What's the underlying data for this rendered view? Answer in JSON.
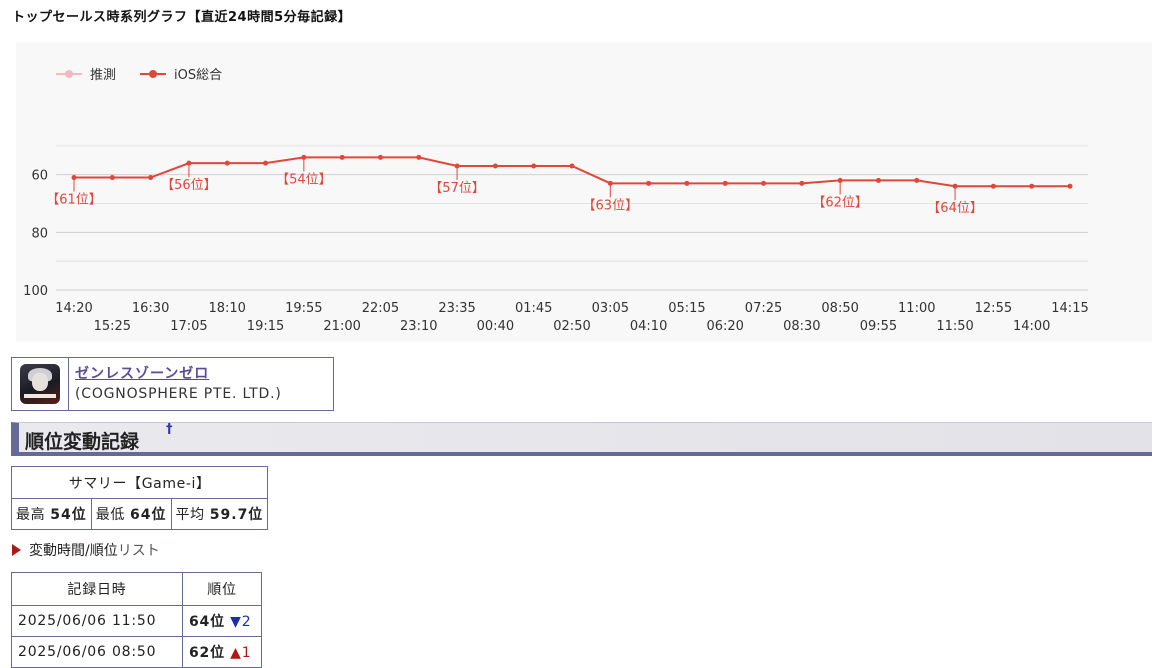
{
  "page_title": "トップセールス時系列グラフ【直近24時間5分毎記録】",
  "legend": [
    {
      "label": "推測",
      "color": "#f7b7c4"
    },
    {
      "label": "iOS総合",
      "color": "#e0473a"
    }
  ],
  "chart_data": {
    "type": "line",
    "x": [
      "14:20",
      "15:25",
      "16:30",
      "17:05",
      "18:10",
      "19:15",
      "19:55",
      "21:00",
      "22:05",
      "23:10",
      "23:35",
      "00:40",
      "01:45",
      "02:50",
      "03:05",
      "04:10",
      "05:15",
      "06:20",
      "07:25",
      "08:30",
      "08:50",
      "09:55",
      "11:00",
      "11:50",
      "12:55",
      "14:00",
      "14:15"
    ],
    "series": [
      {
        "name": "iOS総合",
        "color": "#e0473a",
        "values": [
          61,
          61,
          61,
          56,
          56,
          56,
          54,
          54,
          54,
          54,
          57,
          57,
          57,
          57,
          63,
          63,
          63,
          63,
          63,
          63,
          62,
          62,
          62,
          64,
          64,
          64,
          64
        ]
      }
    ],
    "annotations": [
      {
        "index": 0,
        "label": "【61位】"
      },
      {
        "index": 3,
        "label": "【56位】"
      },
      {
        "index": 6,
        "label": "【54位】"
      },
      {
        "index": 10,
        "label": "【57位】"
      },
      {
        "index": 14,
        "label": "【63位】"
      },
      {
        "index": 20,
        "label": "【62位】"
      },
      {
        "index": 23,
        "label": "【64位】"
      }
    ],
    "yticks": [
      60,
      80,
      100
    ],
    "ylim": [
      40,
      100
    ],
    "y_inverted": true,
    "grid": true,
    "legend_position": "top-left"
  },
  "app": {
    "icon": "app-icon",
    "name": "ゼンレスゾーンゼロ",
    "developer": "(COGNOSPHERE PTE. LTD.)"
  },
  "section": {
    "title": "順位変動記録",
    "anchor": "†"
  },
  "summary": {
    "header": "サマリー【Game-i】",
    "best_label": "最高",
    "best_value": "54位",
    "worst_label": "最低",
    "worst_value": "64位",
    "avg_label": "平均",
    "avg_value": "59.7位"
  },
  "list_toggle": {
    "icon": "triangle-right-icon",
    "label_main": "変動時間/順位",
    "label_sub": "リスト"
  },
  "history": {
    "col_datetime": "記録日時",
    "col_rank": "順位",
    "rows": [
      {
        "datetime": "2025/06/06 11:50",
        "rank": "64位",
        "change": "▼2",
        "direction": "down"
      },
      {
        "datetime": "2025/06/06 08:50",
        "rank": "62位",
        "change": "▲1",
        "direction": "up"
      }
    ]
  }
}
